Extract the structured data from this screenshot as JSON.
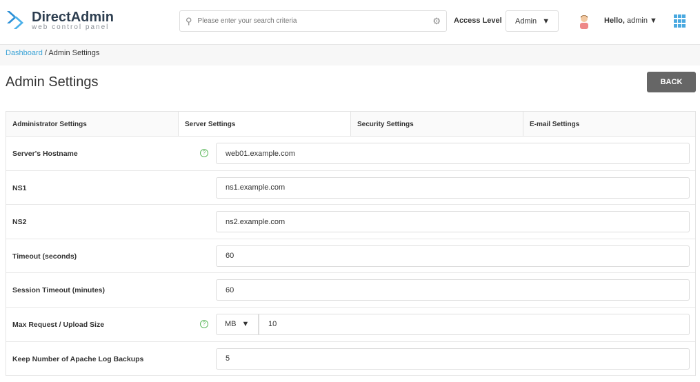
{
  "header": {
    "brand": "DirectAdmin",
    "brand_sub": "web control panel",
    "search_placeholder": "Please enter your search criteria",
    "access_label": "Access Level",
    "access_value": "Admin",
    "greeting": "Hello,",
    "user": "admin",
    "accent": "#3aa3d6"
  },
  "breadcrumb": {
    "home": "Dashboard",
    "separator": " / ",
    "current": "Admin Settings"
  },
  "page": {
    "title": "Admin Settings",
    "back_label": "BACK"
  },
  "tabs": [
    {
      "label": "Administrator Settings"
    },
    {
      "label": "Server Settings",
      "active": true
    },
    {
      "label": "Security Settings"
    },
    {
      "label": "E-mail Settings"
    }
  ],
  "fields": [
    {
      "label": "Server's Hostname",
      "value": "web01.example.com",
      "help": "?"
    },
    {
      "label": "NS1",
      "value": "ns1.example.com"
    },
    {
      "label": "NS2",
      "value": "ns2.example.com"
    },
    {
      "label": "Timeout (seconds)",
      "value": "60"
    },
    {
      "label": "Session Timeout (minutes)",
      "value": "60"
    },
    {
      "label": "Max Request / Upload Size",
      "unit": "MB",
      "value": "10",
      "help": "?"
    },
    {
      "label": "Keep Number of Apache Log Backups",
      "value": "5"
    }
  ]
}
